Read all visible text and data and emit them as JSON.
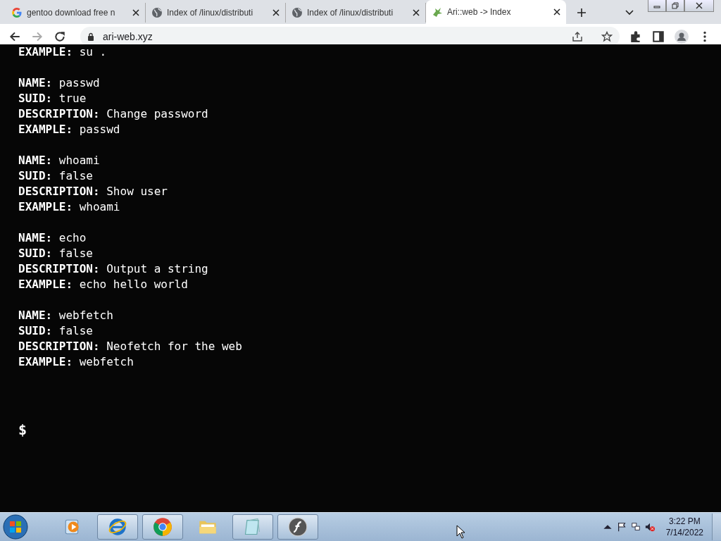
{
  "tabs": [
    {
      "title": "gentoo download free n",
      "selected": false
    },
    {
      "title": "Index of /linux/distributi",
      "selected": false
    },
    {
      "title": "Index of /linux/distributi",
      "selected": false
    },
    {
      "title": "Ari::web -> Index",
      "selected": true
    }
  ],
  "address": "ari-web.xyz",
  "terminal": {
    "entries": [
      [
        {
          "label": "EXAMPLE:",
          "value": "su ."
        }
      ],
      [
        {
          "label": "NAME:",
          "value": "passwd"
        },
        {
          "label": "SUID:",
          "value": "true"
        },
        {
          "label": "DESCRIPTION:",
          "value": "Change password"
        },
        {
          "label": "EXAMPLE:",
          "value": "passwd"
        }
      ],
      [
        {
          "label": "NAME:",
          "value": "whoami"
        },
        {
          "label": "SUID:",
          "value": "false"
        },
        {
          "label": "DESCRIPTION:",
          "value": "Show user"
        },
        {
          "label": "EXAMPLE:",
          "value": "whoami"
        }
      ],
      [
        {
          "label": "NAME:",
          "value": "echo"
        },
        {
          "label": "SUID:",
          "value": "false"
        },
        {
          "label": "DESCRIPTION:",
          "value": "Output a string"
        },
        {
          "label": "EXAMPLE:",
          "value": "echo hello world"
        }
      ],
      [
        {
          "label": "NAME:",
          "value": "webfetch"
        },
        {
          "label": "SUID:",
          "value": "false"
        },
        {
          "label": "DESCRIPTION:",
          "value": "Neofetch for the web"
        },
        {
          "label": "EXAMPLE:",
          "value": "webfetch"
        }
      ]
    ],
    "prompt": "$"
  },
  "taskbar": {
    "apps": [
      {
        "kind": "media",
        "open": false
      },
      {
        "kind": "ie",
        "open": true
      },
      {
        "kind": "chrome",
        "open": true
      },
      {
        "kind": "folder",
        "open": false
      },
      {
        "kind": "notepad",
        "open": true
      },
      {
        "kind": "flash",
        "open": true
      }
    ],
    "time": "3:22 PM",
    "date": "7/14/2022"
  }
}
